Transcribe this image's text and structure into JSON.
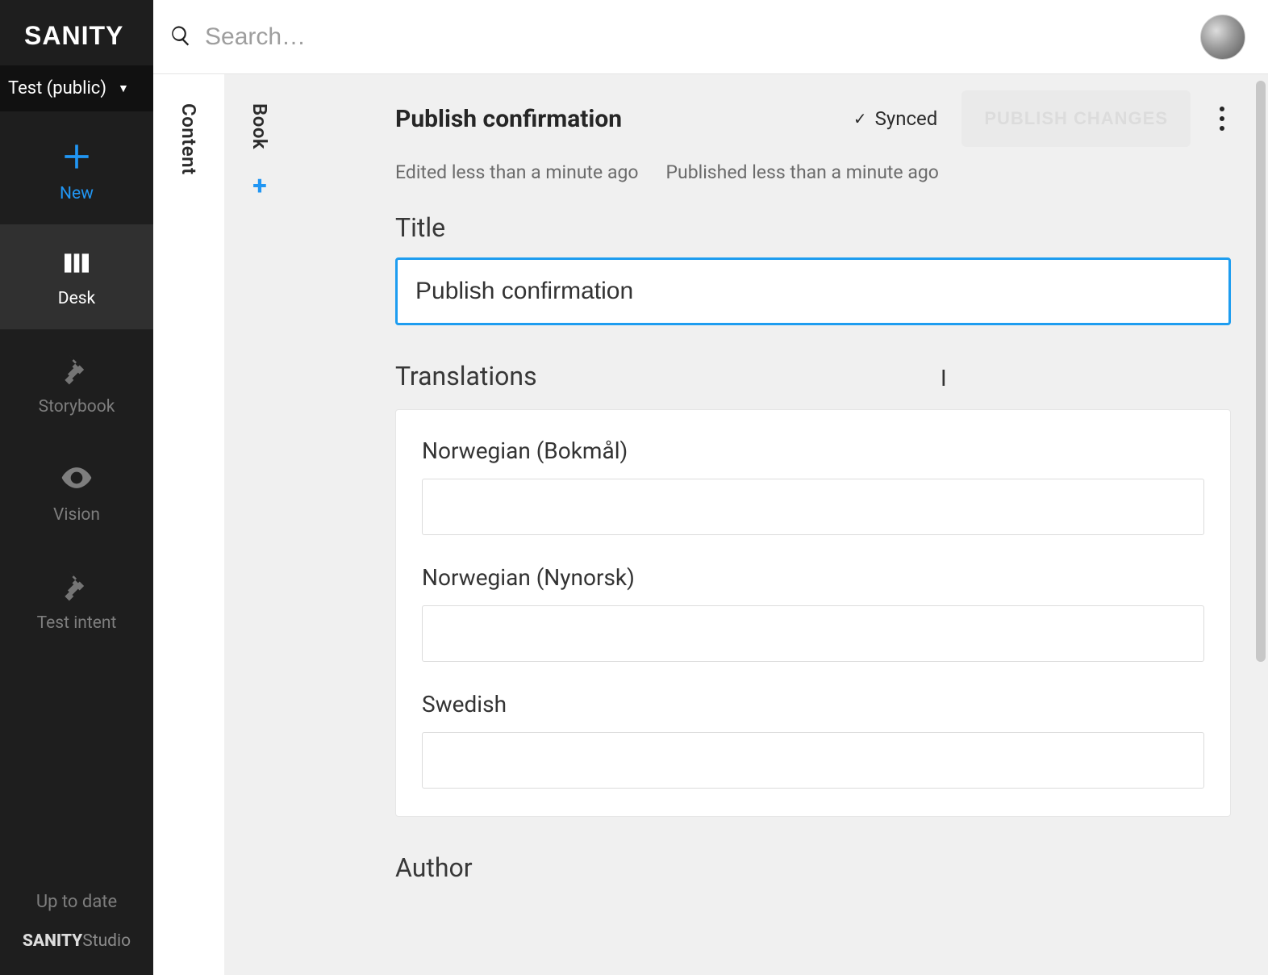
{
  "brand": {
    "logo": "SANITY",
    "footer_bold": "SANITY",
    "footer_light": "Studio"
  },
  "project": {
    "name": "Test (public)"
  },
  "sidebar": {
    "new_label": "New",
    "desk_label": "Desk",
    "storybook_label": "Storybook",
    "vision_label": "Vision",
    "testintent_label": "Test intent",
    "uptodate_label": "Up to date"
  },
  "topbar": {
    "search_placeholder": "Search…"
  },
  "tabs": {
    "content_label": "Content",
    "book_label": "Book"
  },
  "doc": {
    "title": "Publish confirmation",
    "synced_label": "Synced",
    "publish_button": "PUBLISH CHANGES",
    "edited_meta": "Edited less than a minute ago",
    "published_meta": "Published less than a minute ago"
  },
  "fields": {
    "title_label": "Title",
    "title_value": "Publish confirmation",
    "translations_label": "Translations",
    "translations": [
      {
        "label": "Norwegian (Bokmål)",
        "value": ""
      },
      {
        "label": "Norwegian (Nynorsk)",
        "value": ""
      },
      {
        "label": "Swedish",
        "value": ""
      }
    ],
    "author_label": "Author"
  }
}
